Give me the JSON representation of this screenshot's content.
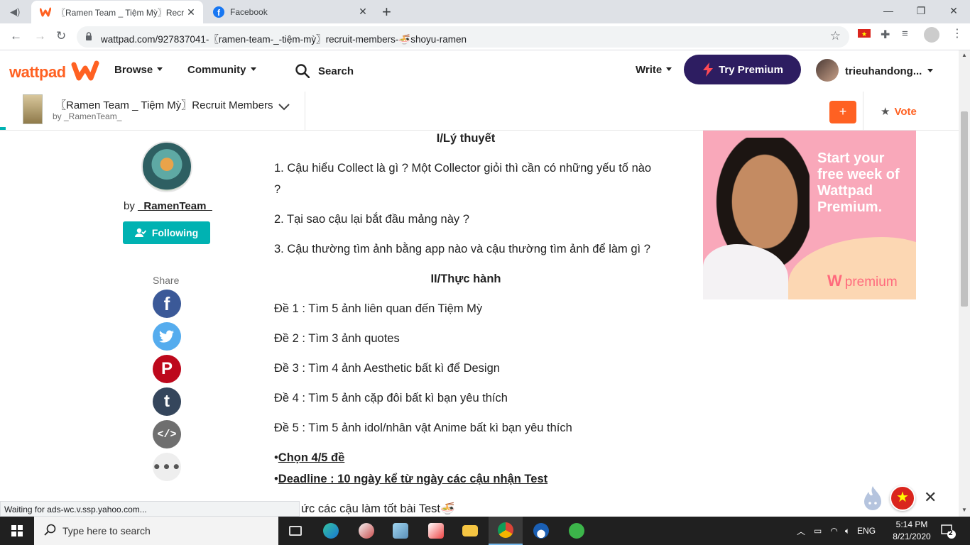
{
  "browser": {
    "tabs": [
      {
        "title": "〖Ramen Team _ Tiệm Mỳ〗Recr",
        "close": "✕"
      },
      {
        "title": "Facebook",
        "close": "✕"
      }
    ],
    "new_tab": "+",
    "url": "wattpad.com/927837041-〖ramen-team-_-tiệm-mỳ〗recruit-members-🍜shoyu-ramen",
    "window_controls": {
      "minimize": "—",
      "maximize": "❐",
      "close": "✕"
    }
  },
  "header": {
    "logo": "wattpad",
    "browse": "Browse",
    "community": "Community",
    "search": "Search",
    "write": "Write",
    "try_premium": "Try Premium",
    "username": "trieuhandong..."
  },
  "story_bar": {
    "title": "〖Ramen Team _ Tiệm Mỳ〗Recruit Members",
    "by": "by _RamenTeam_",
    "add": "+",
    "vote": "Vote"
  },
  "author": {
    "by_prefix": "by",
    "name": "_RamenTeam_",
    "following": "Following",
    "share": "Share"
  },
  "share_icons": [
    "facebook-icon",
    "twitter-icon",
    "pinterest-icon",
    "tumblr-icon",
    "embed-icon",
    "more-icon"
  ],
  "content": {
    "heading1": "I/Lý thuyết",
    "q1a": "1. Cậu hiểu Collect là gì ? Một Collector giỏi thì cần có những yếu tố nào",
    "q1b": "?",
    "q2": "2. Tại sao cậu lại bắt đầu mảng này ?",
    "q3": "3. Cậu thường tìm ảnh bằng app nào và cậu thường tìm ảnh để làm gì ?",
    "heading2": "II/Thực hành",
    "d1": "Đề 1 : Tìm 5 ảnh liên quan đến Tiệm Mỳ",
    "d2": "Đề 2 : Tìm 3 ảnh quotes",
    "d3": "Đề 3 : Tìm 4 ảnh Aesthetic bất kì để Design",
    "d4": "Đề 4 : Tìm 5 ảnh cặp đôi bất kì bạn yêu thích",
    "d5": "Đề 5 : Tìm 5 ảnh idol/nhân vật Anime bất kì bạn yêu thích",
    "bullet": "•",
    "choose": "Chọn 4/5 đề",
    "deadline": "Deadline : 10 ngày kể từ ngày các cậu nhận Test",
    "wish": "ức các cậu làm tốt bài Test🍜"
  },
  "ad": {
    "text": "Start your free week of Wattpad Premium.",
    "brand": "premium"
  },
  "status": "Waiting for ads-wc.v.ssp.yahoo.com...",
  "taskbar": {
    "search_placeholder": "Type here to search",
    "lang": "ENG",
    "time": "5:14 PM",
    "date": "8/21/2020",
    "notifications": "2"
  },
  "colors": {
    "wattpad_orange": "#ff6122",
    "premium_purple": "#2d1d61",
    "teal": "#00b2b2"
  }
}
